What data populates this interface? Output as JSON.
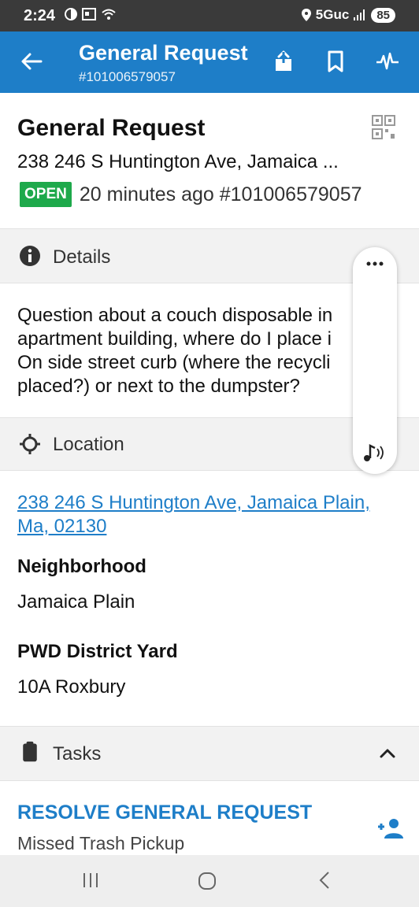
{
  "status_bar": {
    "time": "2:24",
    "network": "5Guc",
    "battery": "85"
  },
  "app_bar": {
    "title": "General Request",
    "subtitle": "#101006579057"
  },
  "header": {
    "title": "General Request",
    "address": "238 246 S Huntington Ave, Jamaica ...",
    "status_badge": "OPEN",
    "status_text": "20 minutes ago #101006579057"
  },
  "details": {
    "label": "Details",
    "lines": [
      "Question about a couch disposable in",
      "apartment building, where do I place i",
      "On side street curb (where the recycli",
      "placed?) or next to the dumpster?"
    ]
  },
  "location": {
    "label": "Location",
    "address_link": "238 246 S Huntington Ave, Jamaica Plain, Ma, 02130",
    "neighborhood_label": "Neighborhood",
    "neighborhood_value": "Jamaica Plain",
    "district_label": "PWD District Yard",
    "district_value": "10A Roxbury"
  },
  "tasks": {
    "label": "Tasks",
    "items": [
      {
        "title": "RESOLVE GENERAL REQUEST",
        "subtitle": "Missed Trash Pickup"
      }
    ]
  },
  "icons": {
    "back": "arrow-left-icon",
    "share": "share-icon",
    "bookmark": "bookmark-icon",
    "activity": "activity-icon",
    "qr": "qr-code-icon",
    "info": "info-icon",
    "location": "crosshair-icon",
    "tasks": "clipboard-icon",
    "assign": "add-person-icon"
  },
  "colors": {
    "primary": "#1e7ec8",
    "open_badge": "#1ea94b",
    "status_bar": "#3a3a3a"
  }
}
